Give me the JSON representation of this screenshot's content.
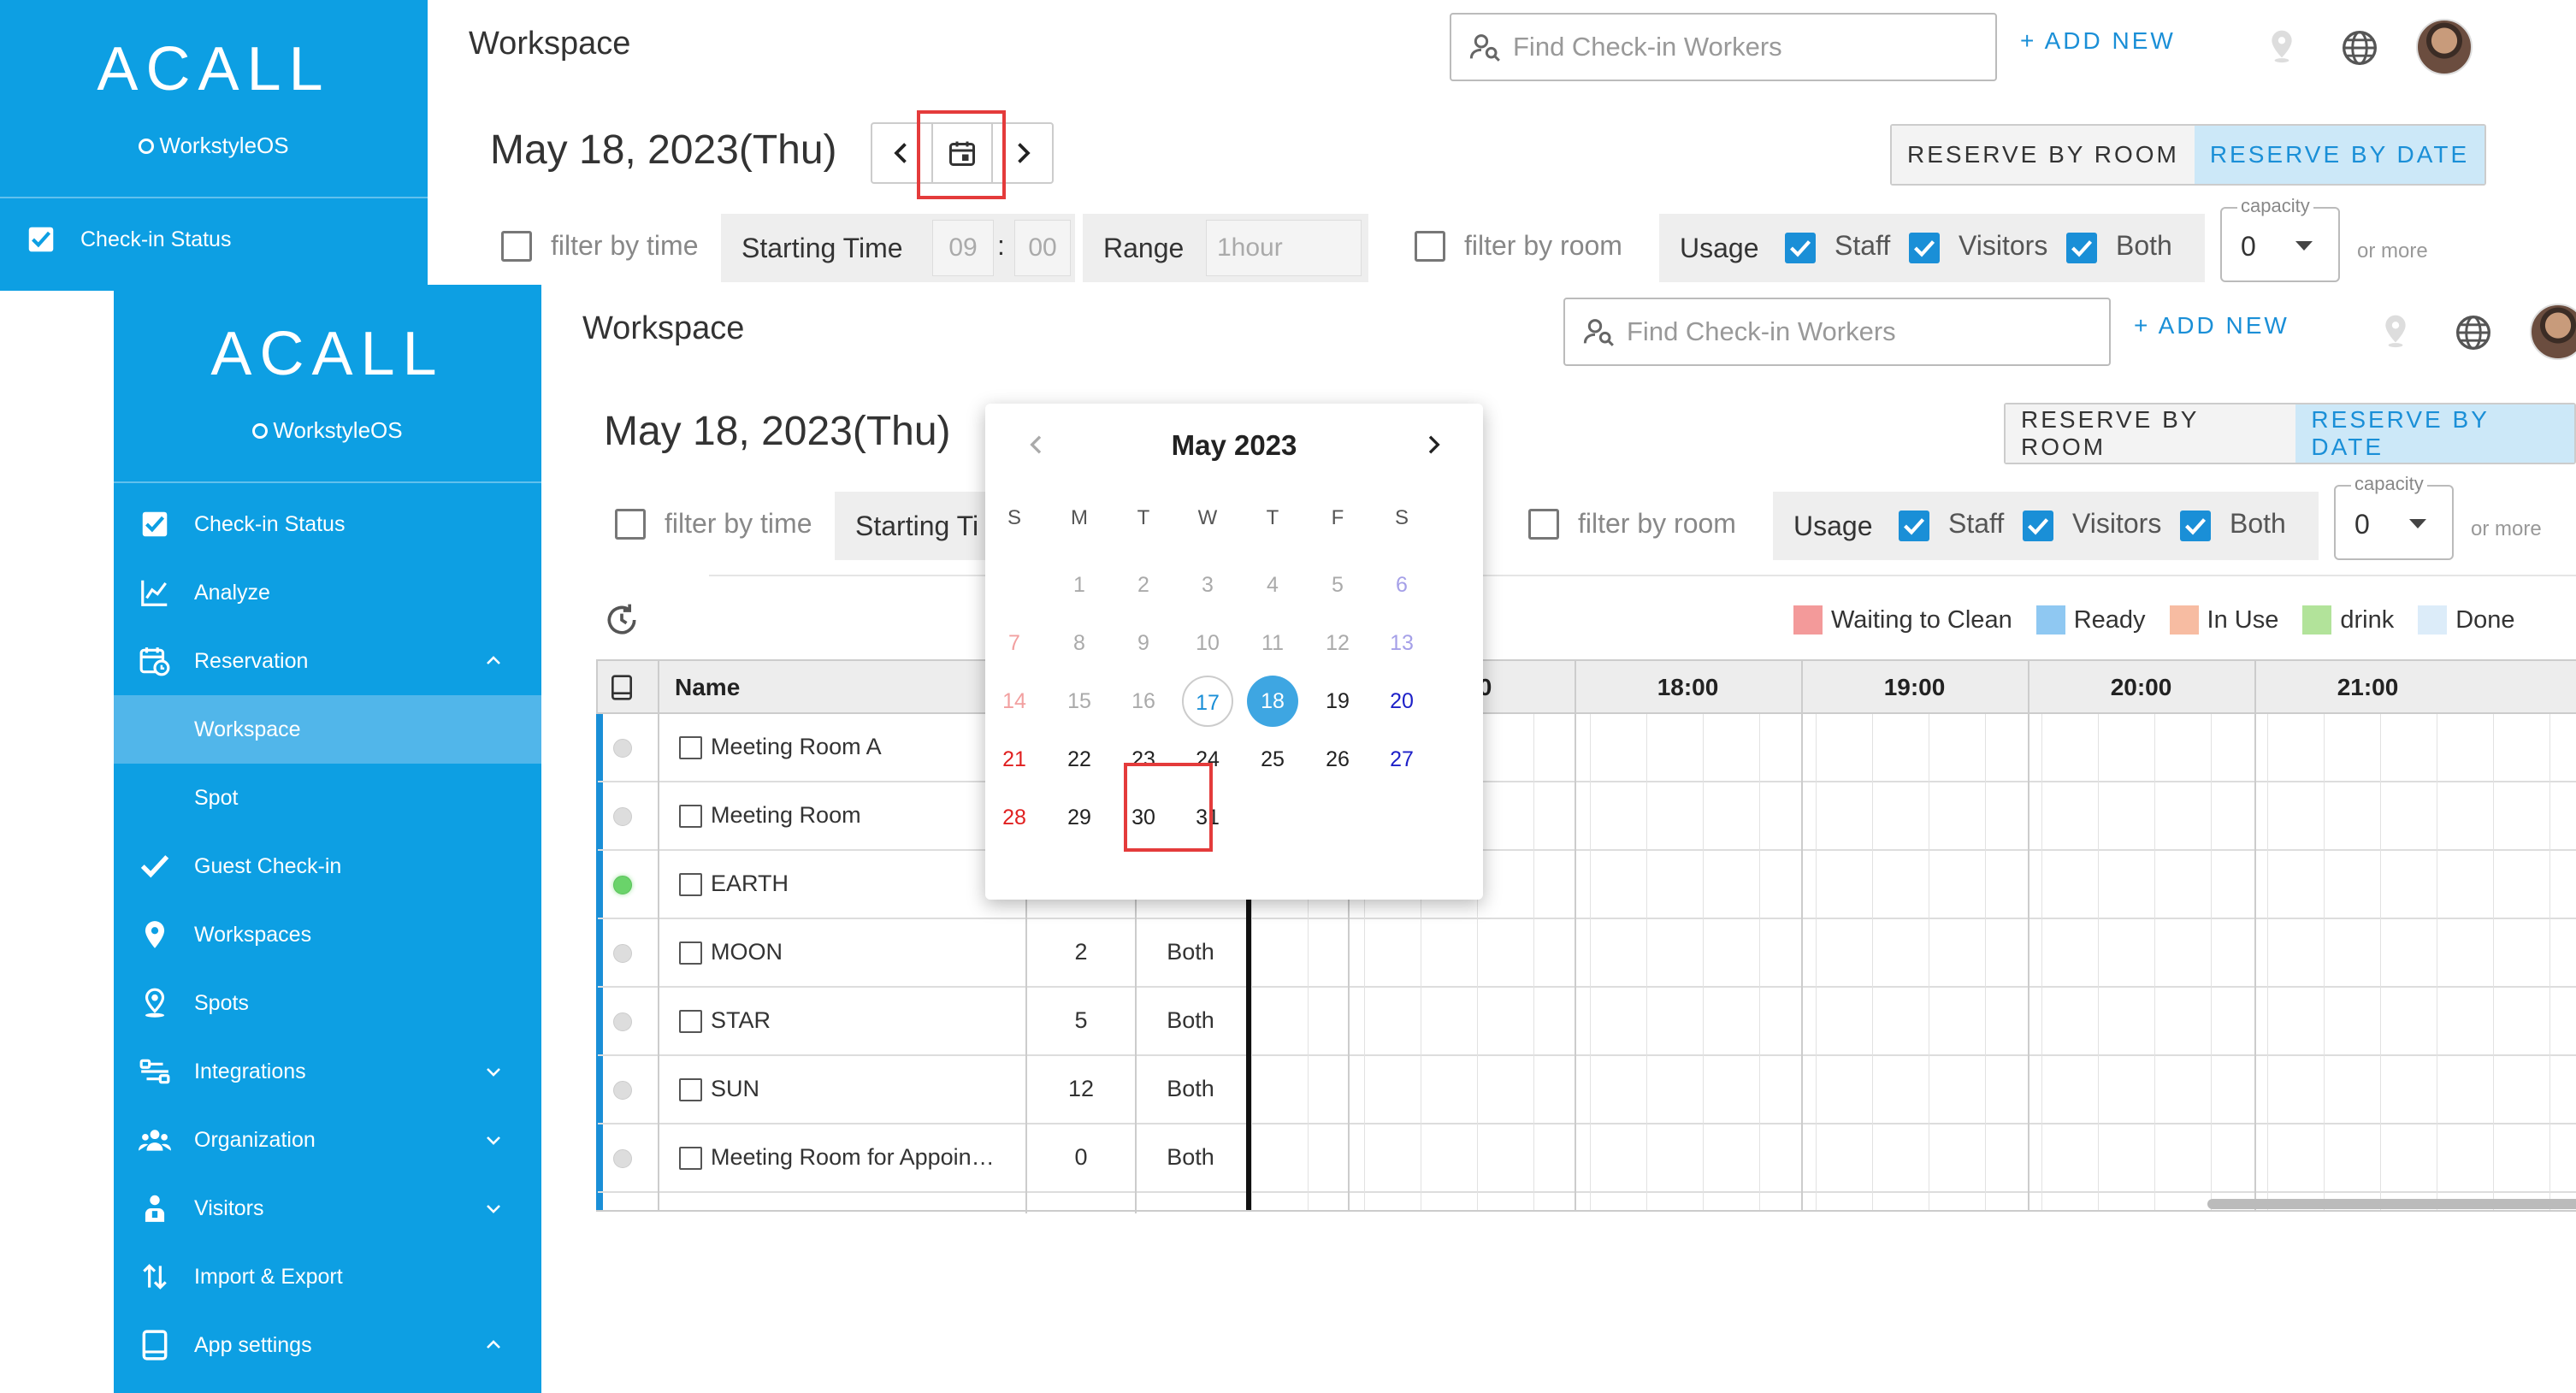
{
  "app": {
    "brand": "ACALL",
    "sub_brand": "WorkstyleOS",
    "page_title": "Workspace"
  },
  "header": {
    "search_placeholder": "Find Check-in Workers",
    "add_new": "+ ADD NEW"
  },
  "sidebar_back": {
    "labels": [
      "Check-in Status",
      "Ana",
      "Res",
      "Wo",
      "Spo",
      "Gue",
      "Wo",
      "Spo",
      "Inte",
      "Org",
      "Visi",
      "Imp",
      "App"
    ]
  },
  "sidebar": {
    "items": [
      {
        "label": "Check-in Status",
        "icon": "check-square-icon"
      },
      {
        "label": "Analyze",
        "icon": "chart-line-icon"
      },
      {
        "label": "Reservation",
        "icon": "calendar-clock-icon",
        "expanded": true
      },
      {
        "label": "Workspace",
        "sub": true,
        "active": true
      },
      {
        "label": "Spot",
        "sub": true
      },
      {
        "label": "Guest Check-in",
        "icon": "check-icon"
      },
      {
        "label": "Workspaces",
        "icon": "map-pin-icon"
      },
      {
        "label": "Spots",
        "icon": "person-pin-icon"
      },
      {
        "label": "Integrations",
        "icon": "integration-icon",
        "collapsed": true
      },
      {
        "label": "Organization",
        "icon": "group-icon",
        "collapsed": true
      },
      {
        "label": "Visitors",
        "icon": "visitor-icon",
        "collapsed": true
      },
      {
        "label": "Import & Export",
        "icon": "import-export-icon"
      },
      {
        "label": "App settings",
        "icon": "tablet-icon",
        "expanded": true
      }
    ]
  },
  "toolbar": {
    "date": "May 18, 2023(Thu)",
    "reserve_by_room": "RESERVE BY ROOM",
    "reserve_by_date": "RESERVE BY DATE"
  },
  "filters": {
    "filter_by_time": "filter by time",
    "starting_time": "Starting Time",
    "starting_time_short": "Starting Ti",
    "hour": "09",
    "colon": ":",
    "minute": "00",
    "range": "Range",
    "range_value": "1hour",
    "filter_by_room": "filter by room",
    "usage": "Usage",
    "staff": "Staff",
    "visitors": "Visitors",
    "both": "Both",
    "capacity_label": "capacity",
    "capacity_value": "0",
    "or_more": "or more"
  },
  "legend": [
    {
      "label": "Waiting to Clean",
      "color": "#f39a9a"
    },
    {
      "label": "Ready",
      "color": "#8fc8f2"
    },
    {
      "label": "In Use",
      "color": "#f7bca2"
    },
    {
      "label": "drink",
      "color": "#b2e39a"
    },
    {
      "label": "Done",
      "color": "#dcecf9"
    }
  ],
  "table": {
    "name_header": "Name",
    "hours": [
      "17:00",
      "18:00",
      "19:00",
      "20:00",
      "21:00"
    ],
    "rows": [
      {
        "name": "Meeting Room A",
        "capacity": "",
        "usage": "",
        "online": false
      },
      {
        "name": "Meeting Room",
        "capacity": "",
        "usage": "",
        "online": false
      },
      {
        "name": "EARTH",
        "capacity": "",
        "usage": "",
        "online": true
      },
      {
        "name": "MOON",
        "capacity": "2",
        "usage": "Both",
        "online": false
      },
      {
        "name": "STAR",
        "capacity": "5",
        "usage": "Both",
        "online": false
      },
      {
        "name": "SUN",
        "capacity": "12",
        "usage": "Both",
        "online": false
      },
      {
        "name": "Meeting Room for Appoin…",
        "capacity": "0",
        "usage": "Both",
        "online": false
      }
    ]
  },
  "calendar": {
    "month": "May 2023",
    "weekdays": [
      "S",
      "M",
      "T",
      "W",
      "T",
      "F",
      "S"
    ],
    "weeks": [
      [
        "",
        "1",
        "2",
        "3",
        "4",
        "5",
        "6"
      ],
      [
        "7",
        "8",
        "9",
        "10",
        "11",
        "12",
        "13"
      ],
      [
        "14",
        "15",
        "16",
        "17",
        "18",
        "19",
        "20"
      ],
      [
        "21",
        "22",
        "23",
        "24",
        "25",
        "26",
        "27"
      ],
      [
        "28",
        "29",
        "30",
        "31",
        "",
        "",
        ""
      ]
    ],
    "today": "17",
    "selected": "18",
    "highlighted": "30"
  }
}
